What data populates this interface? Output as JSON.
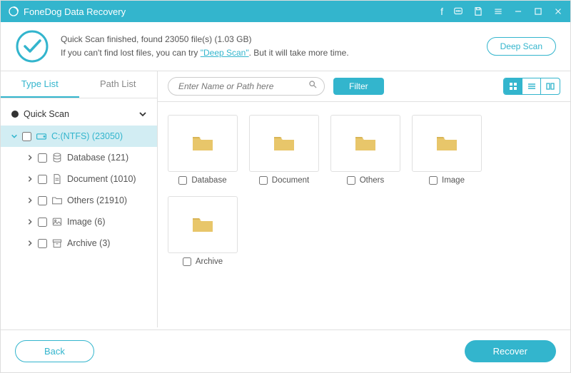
{
  "app": {
    "title": "FoneDog Data Recovery"
  },
  "status": {
    "line1_prefix": "Quick Scan finished, found ",
    "file_count": "23050",
    "line1_mid": " file(s) (",
    "size": "1.03 GB",
    "line1_suffix": ")",
    "line2_prefix": "If you can't find lost files, you can try ",
    "deep_link": "\"Deep Scan\"",
    "line2_suffix": ". But it will take more time.",
    "deep_scan_btn": "Deep Scan"
  },
  "tabs": {
    "type_list": "Type List",
    "path_list": "Path List"
  },
  "tree": {
    "quick_scan": "Quick Scan",
    "drive": "C:(NTFS) (23050)",
    "items": [
      {
        "label": "Database (121)"
      },
      {
        "label": "Document (1010)"
      },
      {
        "label": "Others (21910)"
      },
      {
        "label": "Image (6)"
      },
      {
        "label": "Archive (3)"
      }
    ]
  },
  "toolbar": {
    "search_placeholder": "Enter Name or Path here",
    "filter": "Filter"
  },
  "folders": [
    {
      "label": "Database"
    },
    {
      "label": "Document"
    },
    {
      "label": "Others"
    },
    {
      "label": "Image"
    },
    {
      "label": "Archive"
    }
  ],
  "footer": {
    "back": "Back",
    "recover": "Recover"
  },
  "colors": {
    "accent": "#33b5cd"
  }
}
